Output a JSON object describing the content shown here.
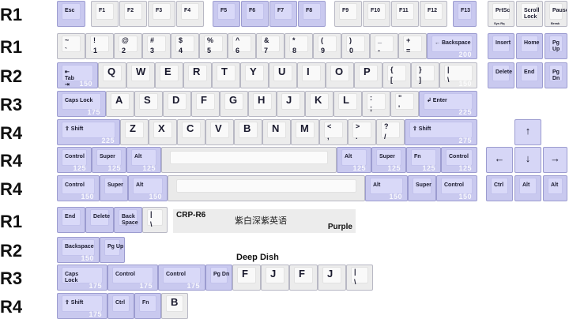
{
  "row_labels": [
    "R1",
    "R1",
    "R2",
    "R3",
    "R4",
    "R4",
    "R4",
    "R1",
    "R2",
    "R3",
    "R4"
  ],
  "keys": [
    {
      "label": "Esc",
      "kind": "mod"
    },
    {
      "label": "F1"
    },
    {
      "label": "F2"
    },
    {
      "label": "F3"
    },
    {
      "label": "F4"
    },
    {
      "label": "F5",
      "kind": "mod"
    },
    {
      "label": "F6",
      "kind": "mod"
    },
    {
      "label": "F7",
      "kind": "mod"
    },
    {
      "label": "F8",
      "kind": "mod"
    },
    {
      "label": "F9"
    },
    {
      "label": "F10"
    },
    {
      "label": "F11"
    },
    {
      "label": "F12"
    },
    {
      "label": "F13",
      "kind": "mod"
    },
    {
      "label": "PrtSc",
      "sub": "Sys Rq"
    },
    {
      "label": "Scroll\nLock"
    },
    {
      "label": "Pause",
      "sub": "Break"
    },
    {
      "top": "~",
      "bot": "`"
    },
    {
      "top": "!",
      "bot": "1"
    },
    {
      "top": "@",
      "bot": "2"
    },
    {
      "top": "#",
      "bot": "3"
    },
    {
      "top": "$",
      "bot": "4"
    },
    {
      "top": "%",
      "bot": "5"
    },
    {
      "top": "^",
      "bot": "6"
    },
    {
      "top": "&",
      "bot": "7"
    },
    {
      "top": "*",
      "bot": "8"
    },
    {
      "top": "(",
      "bot": "9"
    },
    {
      "top": ")",
      "bot": "0"
    },
    {
      "top": "_",
      "bot": "-"
    },
    {
      "top": "+",
      "bot": "="
    },
    {
      "label": "← Backspace",
      "kind": "mod",
      "size": "200"
    },
    {
      "label": "Insert",
      "kind": "mod"
    },
    {
      "label": "Home",
      "kind": "mod"
    },
    {
      "label": "Pg Up",
      "kind": "mod"
    },
    {
      "label": "⇤\nTab\n⇥",
      "kind": "mod",
      "size": "150"
    },
    {
      "big": "Q"
    },
    {
      "big": "W"
    },
    {
      "big": "E"
    },
    {
      "big": "R"
    },
    {
      "big": "T"
    },
    {
      "big": "Y"
    },
    {
      "big": "U"
    },
    {
      "big": "I"
    },
    {
      "big": "O"
    },
    {
      "big": "P"
    },
    {
      "top": "{",
      "bot": "["
    },
    {
      "top": "}",
      "bot": "]"
    },
    {
      "top": "|",
      "bot": "\\",
      "size": "150"
    },
    {
      "label": "Delete",
      "kind": "mod"
    },
    {
      "label": "End",
      "kind": "mod"
    },
    {
      "label": "Pg Dn",
      "kind": "mod"
    },
    {
      "label": "Caps Lock",
      "kind": "mod",
      "size": "175"
    },
    {
      "big": "A"
    },
    {
      "big": "S"
    },
    {
      "big": "D"
    },
    {
      "big": "F"
    },
    {
      "big": "G"
    },
    {
      "big": "H"
    },
    {
      "big": "J"
    },
    {
      "big": "K"
    },
    {
      "big": "L"
    },
    {
      "top": ":",
      "bot": ";"
    },
    {
      "top": "\"",
      "bot": "'"
    },
    {
      "label": "↲ Enter",
      "kind": "mod",
      "size": "225"
    },
    {
      "label": "⇧ Shift",
      "kind": "mod",
      "size": "225"
    },
    {
      "big": "Z"
    },
    {
      "big": "X"
    },
    {
      "big": "C"
    },
    {
      "big": "V"
    },
    {
      "big": "B"
    },
    {
      "big": "N"
    },
    {
      "big": "M"
    },
    {
      "top": "<",
      "bot": ","
    },
    {
      "top": ">",
      "bot": "."
    },
    {
      "top": "?",
      "bot": "/"
    },
    {
      "label": "⇧ Shift",
      "kind": "mod",
      "size": "275"
    },
    {
      "label": "↑",
      "kind": "mod",
      "arrow": true
    },
    {
      "label": "Control",
      "kind": "mod",
      "size": "125"
    },
    {
      "label": "Super",
      "kind": "mod",
      "size": "125"
    },
    {
      "label": "Alt",
      "kind": "mod",
      "size": "125"
    },
    {
      "kind": "space"
    },
    {
      "label": "Alt",
      "kind": "mod",
      "size": "125"
    },
    {
      "label": "Super",
      "kind": "mod",
      "size": "125"
    },
    {
      "label": "Fn",
      "kind": "mod",
      "size": "125"
    },
    {
      "label": "Control",
      "kind": "mod",
      "size": "125"
    },
    {
      "label": "←",
      "kind": "mod",
      "arrow": true
    },
    {
      "label": "↓",
      "kind": "mod",
      "arrow": true
    },
    {
      "label": "→",
      "kind": "mod",
      "arrow": true
    },
    {
      "label": "Control",
      "kind": "mod",
      "size": "150"
    },
    {
      "label": "Super",
      "kind": "mod"
    },
    {
      "label": "Alt",
      "kind": "mod",
      "size": "150"
    },
    {
      "kind": "space"
    },
    {
      "label": "Alt",
      "kind": "mod",
      "size": "150"
    },
    {
      "label": "Super",
      "kind": "mod"
    },
    {
      "label": "Control",
      "kind": "mod",
      "size": "150"
    },
    {
      "label": "Ctrl",
      "kind": "mod"
    },
    {
      "label": "Alt",
      "kind": "mod"
    },
    {
      "label": "Alt",
      "kind": "mod"
    },
    {
      "label": "End",
      "kind": "mod"
    },
    {
      "label": "Delete",
      "kind": "mod"
    },
    {
      "label": "Back\nSpace",
      "kind": "mod"
    },
    {
      "top": "|",
      "bot": "\\"
    },
    {
      "label": "Backspace",
      "kind": "mod",
      "size": "150"
    },
    {
      "label": "Pg Up",
      "kind": "mod"
    },
    {
      "label": "Caps\nLock",
      "kind": "mod",
      "size": "175"
    },
    {
      "label": "Control",
      "kind": "mod",
      "size": "175"
    },
    {
      "label": "Control",
      "kind": "mod",
      "size": "175"
    },
    {
      "label": "Pg Dn",
      "kind": "mod"
    },
    {
      "big": "F"
    },
    {
      "big": "J"
    },
    {
      "big": "F"
    },
    {
      "big": "J"
    },
    {
      "top": "|",
      "bot": "\\"
    },
    {
      "label": "⇧ Shift",
      "kind": "mod",
      "size": "175"
    },
    {
      "label": "Ctrl",
      "kind": "mod"
    },
    {
      "label": "Fn",
      "kind": "mod"
    },
    {
      "big": "B"
    }
  ],
  "colorway": {
    "code": "CRP-R6",
    "cjk": "紫白深紫英语",
    "name": "Purple"
  },
  "novelties_title": "Deep Dish",
  "colors": {
    "alpha": "#ececec",
    "modifier": "#c9c9ef",
    "legend": "#1a1a2e"
  }
}
